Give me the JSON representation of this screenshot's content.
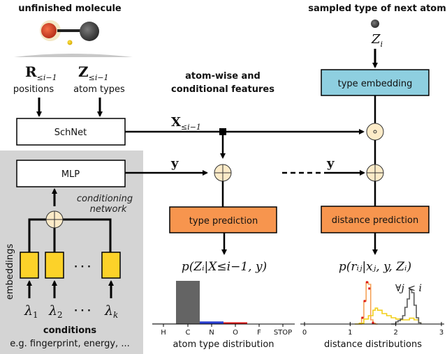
{
  "titles": {
    "unfinished_molecule": "unfinished molecule",
    "sampled_type": "sampled type of next atom",
    "features": [
      "atom-wise and",
      "conditional features"
    ]
  },
  "inputs": {
    "positions_symbol": "R",
    "positions_sub": "≤i−1",
    "positions_label": "positions",
    "types_symbol": "Z",
    "types_sub": "≤i−1",
    "types_label": "atom types",
    "next_type_symbol": "Z",
    "next_type_sub": "i"
  },
  "blocks": {
    "schnet": "SchNet",
    "mlp": "MLP",
    "type_embedding": "type embedding",
    "type_prediction": "type prediction",
    "distance_prediction": "distance prediction"
  },
  "signals": {
    "x_symbol": "X",
    "x_sub": "≤i−1",
    "y_left": "y",
    "y_right": "y"
  },
  "conditioning": {
    "network_label": [
      "conditioning",
      "network"
    ],
    "embeddings_label": "embeddings",
    "lambdas": [
      {
        "sym": "λ",
        "sub": "1"
      },
      {
        "sym": "λ",
        "sub": "2"
      },
      {
        "sym": "λ",
        "sub": "k"
      }
    ],
    "ellipsis": "· · ·",
    "conditions_title": "conditions",
    "conditions_examples": "e.g. fingerprint, energy, ..."
  },
  "formulas": {
    "type_dist": "p(Zᵢ|X≤i−1, y)",
    "dist_dist": "p(rᵢⱼ|xⱼ, y, Zᵢ)",
    "forall": "∀j < i"
  },
  "colors": {
    "embedding_block": "#8ecfe0",
    "prediction_block": "#f7954e",
    "operator_fill": "#fdebc8",
    "condition_panel": "#d4d4d4",
    "embedding_cells": "#fcd229",
    "carbon": "#646464",
    "nitrogen": "#2a3fd0",
    "oxygen": "#dd1515",
    "hydrogen": "#e0e0e0"
  },
  "chart_data": [
    {
      "type": "bar",
      "title": "atom type distribution",
      "xlabel": "atom type distribution",
      "categories": [
        "H",
        "C",
        "N",
        "O",
        "F",
        "STOP"
      ],
      "values": [
        0.03,
        1.0,
        0.06,
        0.04,
        0.0,
        0.0
      ],
      "colors": [
        "#e0e0e0",
        "#646464",
        "#2a3fd0",
        "#dd1515",
        "#cccccc",
        "#cccccc"
      ],
      "ylim": [
        0,
        1.0
      ],
      "grid": false
    },
    {
      "type": "line",
      "title": "distance distributions",
      "xlabel": "distance distributions",
      "xticks": [
        0,
        1,
        2,
        3
      ],
      "xlim": [
        0,
        3
      ],
      "ylim": [
        0,
        1.0
      ],
      "annotation": "∀j < i",
      "series": [
        {
          "name": "orange",
          "color": "#f5a35a",
          "x": [
            1.2,
            1.25,
            1.3,
            1.35,
            1.4,
            1.45,
            1.5,
            1.55,
            1.6
          ],
          "y": [
            0.0,
            0.15,
            0.55,
            1.0,
            0.95,
            0.1,
            0.02,
            0.0,
            0.0
          ]
        },
        {
          "name": "red markers",
          "color": "#dd1515",
          "x": [
            1.27,
            1.32,
            1.37,
            1.42,
            1.5
          ],
          "y": [
            0.15,
            0.55,
            1.0,
            0.85,
            0.03
          ]
        },
        {
          "name": "yellow",
          "color": "#f2cf1a",
          "x": [
            1.1,
            1.2,
            1.3,
            1.4,
            1.5,
            1.55,
            1.6,
            1.7,
            1.8,
            1.9,
            2.0,
            2.1,
            2.2,
            2.3,
            2.4,
            2.5,
            2.55
          ],
          "y": [
            0.0,
            0.02,
            0.12,
            0.2,
            0.33,
            0.38,
            0.33,
            0.25,
            0.2,
            0.15,
            0.12,
            0.1,
            0.1,
            0.14,
            0.1,
            0.03,
            0.0
          ]
        },
        {
          "name": "gray",
          "color": "#5a5a5a",
          "x": [
            1.9,
            2.0,
            2.05,
            2.1,
            2.15,
            2.2,
            2.25,
            2.3,
            2.35,
            2.4,
            2.45,
            2.5,
            2.55
          ],
          "y": [
            0.0,
            0.05,
            0.08,
            0.12,
            0.2,
            0.4,
            0.6,
            0.82,
            0.75,
            0.45,
            0.15,
            0.03,
            0.0
          ]
        }
      ]
    }
  ]
}
